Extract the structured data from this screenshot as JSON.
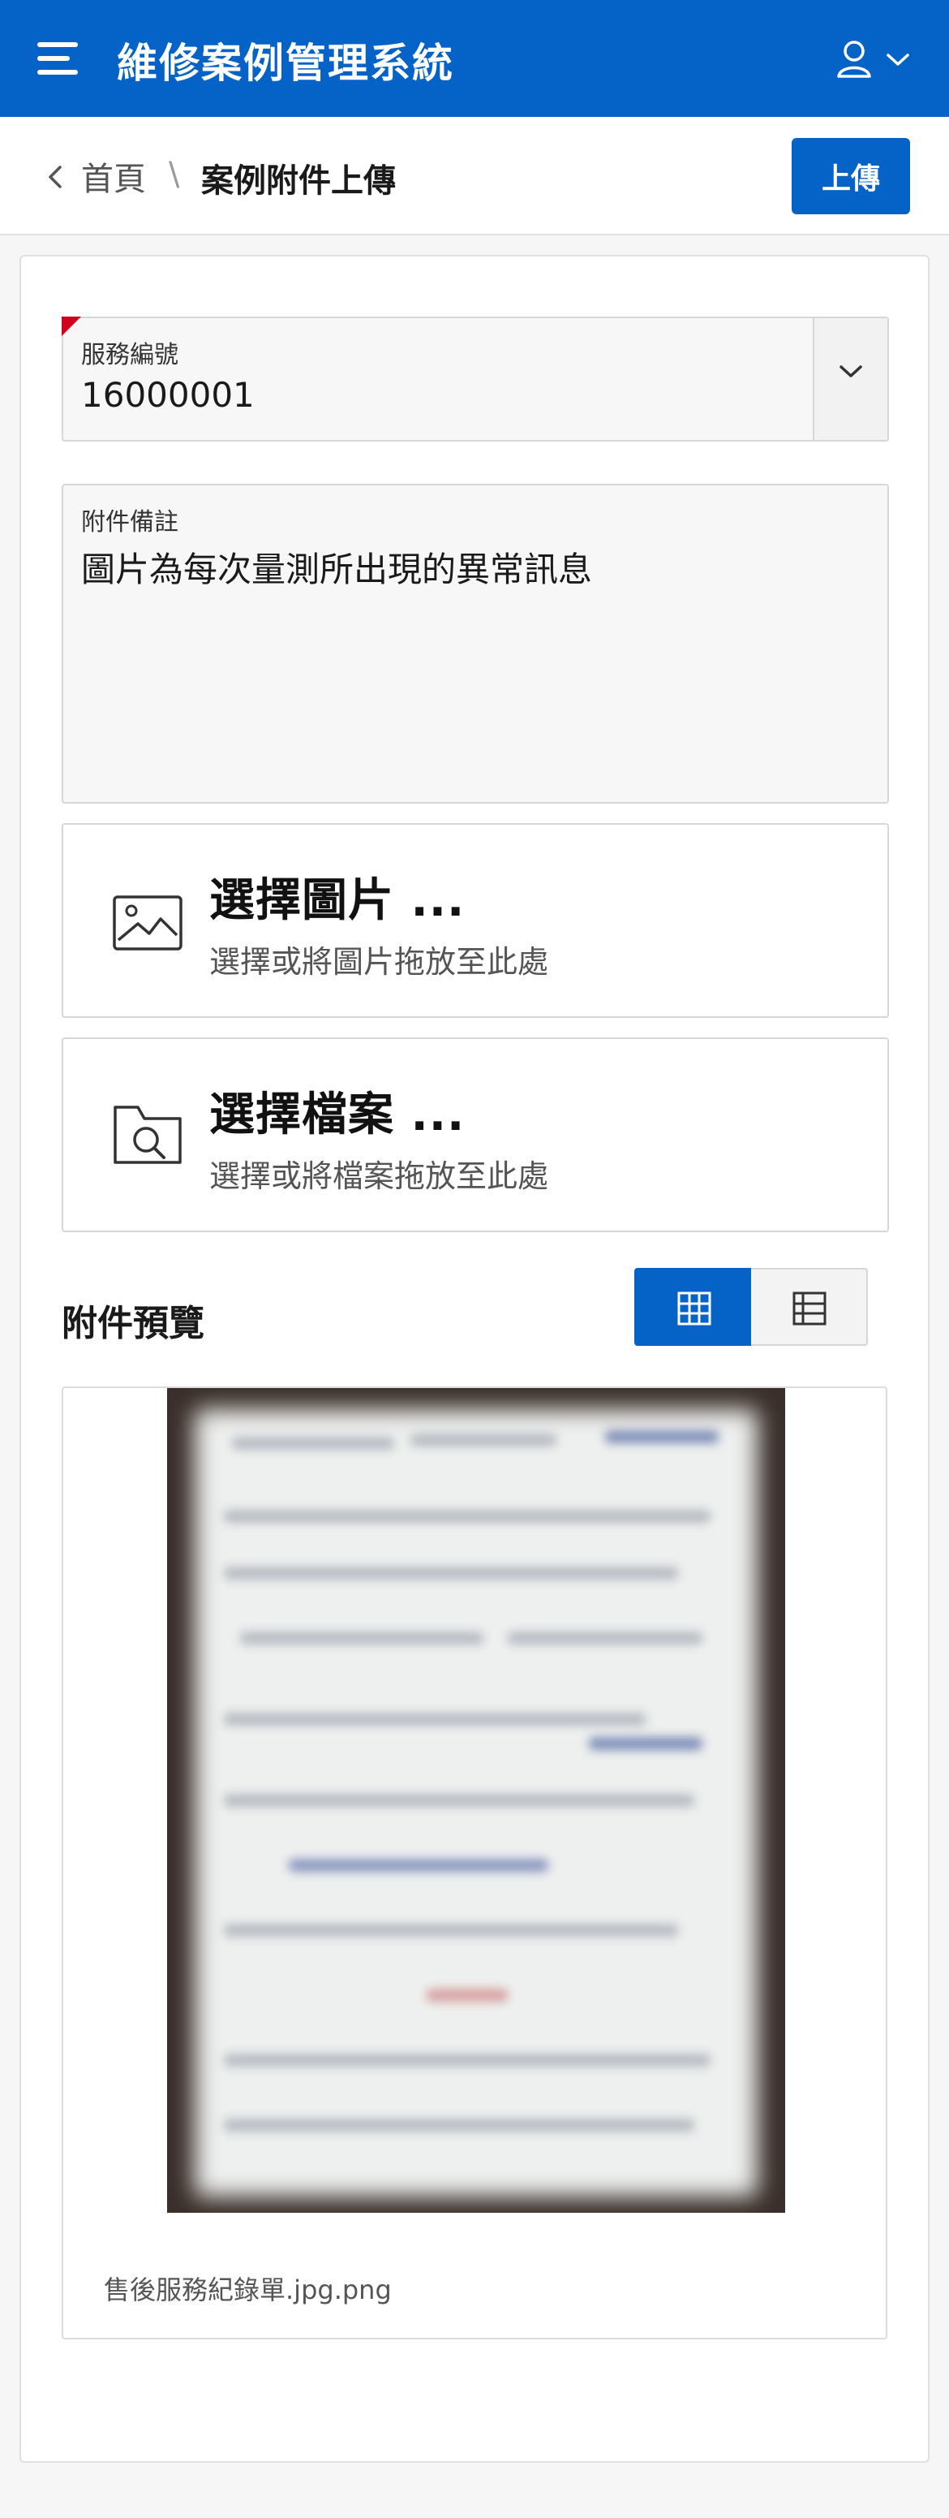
{
  "header": {
    "title": "維修案例管理系統",
    "menu_icon": "hamburger-menu-icon",
    "user_icon": "user-icon"
  },
  "breadcrumb": {
    "home": "首頁",
    "separator": "\\",
    "current": "案例附件上傳"
  },
  "toolbar": {
    "upload_label": "上傳"
  },
  "form": {
    "service_no": {
      "label": "服務編號",
      "value": "16000001"
    },
    "note": {
      "label": "附件備註",
      "value": "圖片為每次量測所出現的異常訊息"
    }
  },
  "dropzones": {
    "image": {
      "title": "選擇圖片 ...",
      "subtitle": "選擇或將圖片拖放至此處",
      "icon": "image-icon"
    },
    "file": {
      "title": "選擇檔案 ...",
      "subtitle": "選擇或將檔案拖放至此處",
      "icon": "folder-search-icon"
    }
  },
  "preview": {
    "title": "附件預覽",
    "views": [
      "grid",
      "list"
    ],
    "selected_view": "grid",
    "items": [
      {
        "caption": "售後服務紀錄單.jpg.png"
      }
    ]
  },
  "colors": {
    "primary": "#0562c6",
    "required_flag": "#d0021b"
  }
}
